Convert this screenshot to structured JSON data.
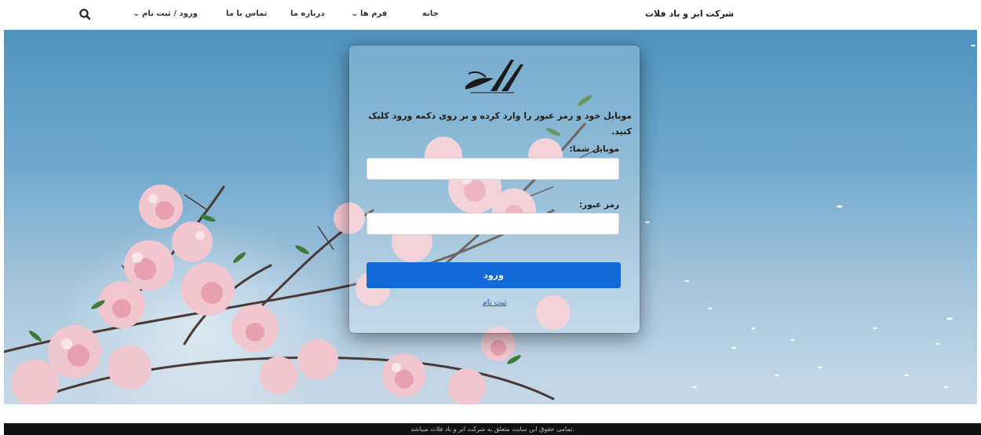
{
  "header": {
    "brand": "شرکت ابر و باد فلات",
    "nav": {
      "home": "خانه",
      "forms": "فرم ها",
      "about": "درباره ما",
      "contact": "تماس با ما",
      "login": "ورود / ثبت نام"
    },
    "icons": {
      "search": "search-icon",
      "dropdown": "chevron-down-icon"
    }
  },
  "login": {
    "logo_text": "شرکت ابر و باد فلات",
    "instruction": "موبایل خود و رمز عبور را وارد کرده و بر روی دکمه ورود کلیک کنید.",
    "mobile_label": "موبایل شما:",
    "mobile_value": "",
    "password_label": "رمز عبور:",
    "password_value": "",
    "submit_label": "ورود",
    "register_label": "ثبت نام"
  },
  "footer": {
    "copyright": "تمامی حقوق این سایت متعلق به شرکت ابر و باد فلات میباشد."
  },
  "colors": {
    "accent": "#1269d8",
    "footer_bg": "#121212",
    "sky": "#6ea8cd"
  }
}
